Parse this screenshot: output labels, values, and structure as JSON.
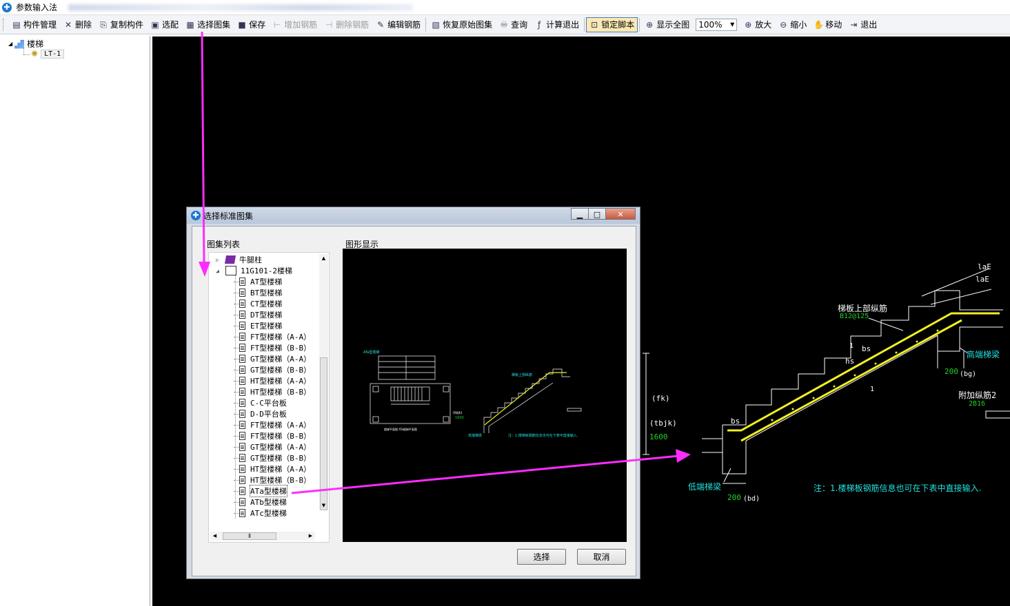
{
  "window": {
    "title": "参数输入法"
  },
  "toolbar": {
    "items": [
      {
        "label": "构件管理",
        "icon": "component-manager-icon",
        "enabled": true
      },
      {
        "label": "删除",
        "icon": "delete-x-icon",
        "enabled": true
      },
      {
        "label": "复制构件",
        "icon": "copy-component-icon",
        "enabled": true
      },
      {
        "label": "选配",
        "icon": "select-config-icon",
        "enabled": true
      },
      {
        "label": "选择图集",
        "icon": "select-atlas-icon",
        "enabled": true
      },
      {
        "label": "保存",
        "icon": "save-disk-icon",
        "enabled": true
      },
      {
        "label": "增加钢筋",
        "icon": "add-rebar-icon",
        "enabled": false
      },
      {
        "label": "删除钢筋",
        "icon": "delete-rebar-icon",
        "enabled": false
      },
      {
        "label": "编辑钢筋",
        "icon": "edit-rebar-icon",
        "enabled": true
      },
      {
        "label": "恢复原始图集",
        "icon": "restore-atlas-icon",
        "enabled": true
      },
      {
        "label": "查询",
        "icon": "binoculars-icon",
        "enabled": true
      },
      {
        "label": "计算退出",
        "icon": "fx-icon",
        "enabled": true
      },
      {
        "label": "锁定脚本",
        "icon": "lock-icon",
        "enabled": true,
        "active": true
      },
      {
        "label": "显示全图",
        "icon": "zoom-fit-icon",
        "enabled": true
      },
      {
        "label": "放大",
        "icon": "zoom-in-icon",
        "enabled": true
      },
      {
        "label": "缩小",
        "icon": "zoom-out-icon",
        "enabled": true
      },
      {
        "label": "移动",
        "icon": "move-hand-icon",
        "enabled": true
      },
      {
        "label": "退出",
        "icon": "exit-icon",
        "enabled": true
      }
    ],
    "zoom_value": "100%"
  },
  "tree": {
    "root": "楼梯",
    "child": "LT-1"
  },
  "dialog": {
    "title": "选择标准图集",
    "list_label": "图集列表",
    "preview_label": "图形显示",
    "items": [
      {
        "label": "牛腿柱",
        "kind": "book-purple"
      },
      {
        "label": "11G101-2楼梯",
        "kind": "book-open"
      },
      {
        "label": "AT型楼梯",
        "kind": "doc"
      },
      {
        "label": "BT型楼梯",
        "kind": "doc"
      },
      {
        "label": "CT型楼梯",
        "kind": "doc"
      },
      {
        "label": "DT型楼梯",
        "kind": "doc"
      },
      {
        "label": "ET型楼梯",
        "kind": "doc"
      },
      {
        "label": "FT型楼梯（A-A）",
        "kind": "doc"
      },
      {
        "label": "FT型楼梯（B-B）",
        "kind": "doc"
      },
      {
        "label": "GT型楼梯（A-A）",
        "kind": "doc"
      },
      {
        "label": "GT型楼梯（B-B）",
        "kind": "doc"
      },
      {
        "label": "HT型楼梯（A-A）",
        "kind": "doc"
      },
      {
        "label": "HT型楼梯（B-B）",
        "kind": "doc"
      },
      {
        "label": "C-C平台板",
        "kind": "doc"
      },
      {
        "label": "D-D平台板",
        "kind": "doc"
      },
      {
        "label": "FT型楼梯（A-A）",
        "kind": "doc"
      },
      {
        "label": "FT型楼梯（B-B）",
        "kind": "doc"
      },
      {
        "label": "GT型楼梯（A-A）",
        "kind": "doc"
      },
      {
        "label": "GT型楼梯（B-B）",
        "kind": "doc"
      },
      {
        "label": "HT型楼梯（A-A）",
        "kind": "doc"
      },
      {
        "label": "HT型楼梯（B-B）",
        "kind": "doc"
      },
      {
        "label": "ATa型楼梯",
        "kind": "doc",
        "selected": true
      },
      {
        "label": "ATb型楼梯",
        "kind": "doc"
      },
      {
        "label": "ATc型楼梯",
        "kind": "doc"
      }
    ],
    "select_button": "选择",
    "cancel_button": "取消"
  },
  "drawing": {
    "laE_1": "laE",
    "laE_2": "laE",
    "top_rebar_label": "梯板上部纵筋",
    "top_rebar_value": "B12@125",
    "bs_top": "bs",
    "hs": "hs",
    "one_a": "1",
    "one_b": "1",
    "high_beam": "高端梯梁",
    "dim_200_bg": "200",
    "bg": "(bg)",
    "extra_rebar_label": "附加纵筋2",
    "extra_rebar_value": "2B16",
    "bs_low": "bs",
    "fk": "(fk)",
    "tbjk": "(tbjk)",
    "dim_1600": "1600",
    "low_beam": "低端梯梁",
    "dim_200_bd": "200",
    "bd": "(bd)",
    "note": "注：1.楼梯板钢筋信息也可在下表中直接输入."
  },
  "colors": {
    "annotation_arrow": "#ff2cff",
    "cad_background": "#000000",
    "rebar": "#f0f020",
    "cad_text_cyan": "#22e0e0",
    "cad_text_green": "#22d22a"
  }
}
